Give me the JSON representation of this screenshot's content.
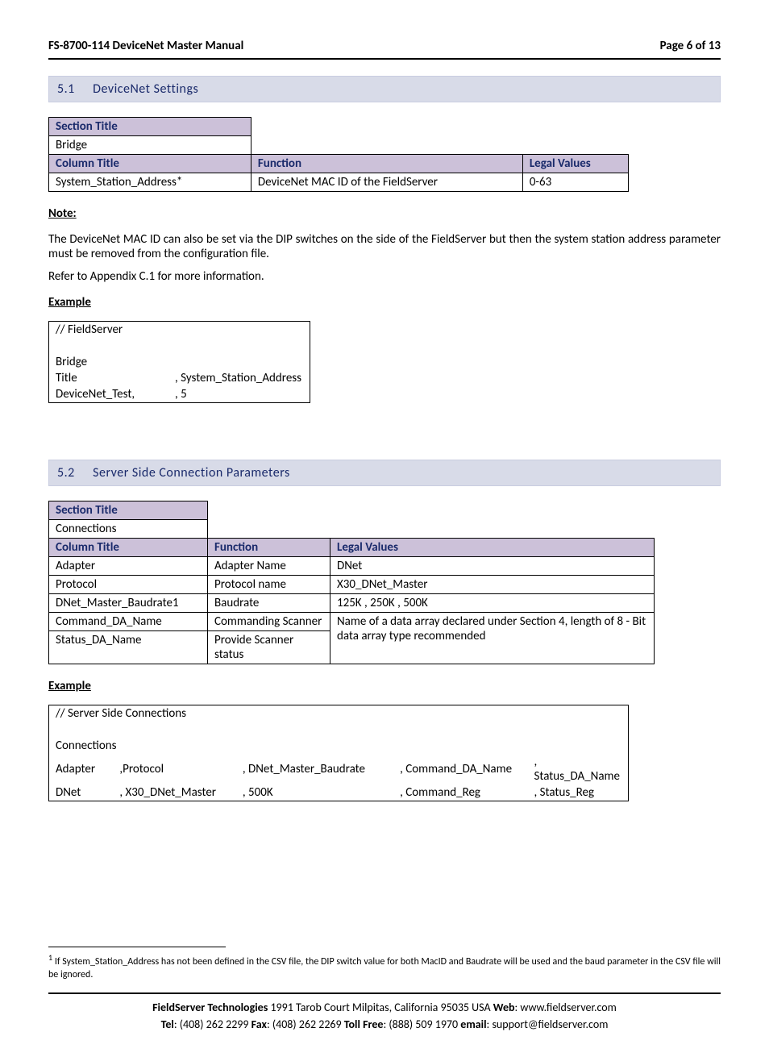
{
  "header": {
    "left": "FS-8700-114 DeviceNet Master Manual",
    "right": "Page 6 of 13"
  },
  "section51": {
    "number": "5.1",
    "title": "DeviceNet Settings",
    "table": {
      "h1": "Section Title",
      "r1": "Bridge",
      "h2a": "Column Title",
      "h2b": "Function",
      "h2c": "Legal Values",
      "r2a": "System_Station_Address*",
      "r2b": "DeviceNet MAC ID of the FieldServer",
      "r2c": "0-63"
    },
    "note_label": "Note:",
    "note_text1": "The DeviceNet MAC ID can also be set via the DIP switches on the side of the FieldServer but then the system station address parameter must be removed from the configuration file.",
    "note_text2": "Refer to Appendix C.1 for more information.",
    "example_label": "Example",
    "example": {
      "l1": "// FieldServer",
      "l2a": "Bridge",
      "l3a": "Title",
      "l3b": ", System_Station_Address",
      "l4a": "DeviceNet_Test,",
      "l4b": ", 5"
    }
  },
  "section52": {
    "number": "5.2",
    "title": "Server Side Connection Parameters",
    "table": {
      "h1": "Section Title",
      "r1": "Connections",
      "h2a": "Column Title",
      "h2b": "Function",
      "h2c": "Legal Values",
      "rAa": "Adapter",
      "rAb": "Adapter Name",
      "rAc": "DNet",
      "rBa": "Protocol",
      "rBb": "Protocol name",
      "rBc": "X30_DNet_Master",
      "rCa": "DNet_Master_Baudrate1",
      "rCb": "Baudrate",
      "rCc": "125K , 250K , 500K",
      "rDa": "Command_DA_Name",
      "rDb": "Commanding Scanner",
      "rEa": "Status_DA_Name",
      "rEb": "Provide Scanner status",
      "rDEc": "Name of a data array declared under Section 4, length of 8 - Bit data array type recommended"
    },
    "example_label": "Example",
    "example": {
      "l1": "//     Server Side Connections",
      "l2": "Connections",
      "l3a": "Adapter",
      "l3b": ",Protocol",
      "l3c": ", DNet_Master_Baudrate",
      "l3d": ", Command_DA_Name",
      "l3e": ", Status_DA_Name",
      "l4a": "DNet",
      "l4b": ", X30_DNet_Master",
      "l4c": ", 500K",
      "l4d": ", Command_Reg",
      "l4e": ", Status_Reg"
    }
  },
  "footnote": {
    "mark": "1",
    "text": " If System_Station_Address has not been defined in the CSV file, the DIP switch value for both MacID and Baudrate will be used and the baud parameter in the CSV file will be ignored."
  },
  "footer": {
    "line1_b1": "FieldServer Technologies",
    "line1_t1": " 1991 Tarob Court Milpitas, California 95035 USA   ",
    "line1_b2": "Web",
    "line1_t2": ": www.fieldserver.com",
    "line2_b1": "Tel",
    "line2_t1": ": (408) 262 2299   ",
    "line2_b2": "Fax",
    "line2_t2": ": (408) 262 2269   ",
    "line2_b3": "Toll Free",
    "line2_t3": ": (888) 509 1970   ",
    "line2_b4": "email",
    "line2_t4": ": support@fieldserver.com"
  }
}
